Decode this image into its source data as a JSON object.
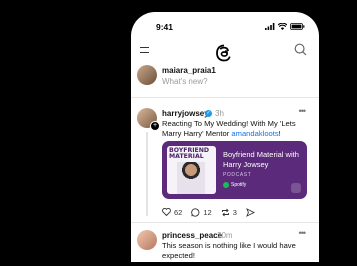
{
  "status_bar": {
    "time": "9:41"
  },
  "compose": {
    "username": "maiara_praia1",
    "placeholder": "What's new?"
  },
  "post": {
    "author": "harryjowsey",
    "age": "3h",
    "text": "Reacting To My Wedding! With My 'Lets Marry Harry' Mentor ",
    "mention": "amandakloots",
    "text_end": "!",
    "card": {
      "cover_title": "BOYFRIEND MATERIAL",
      "title": "Boyfriend Material with Harry Jowsey",
      "subtitle": "PODCAST",
      "brand": "Spotify"
    },
    "actions": {
      "likes": "62",
      "comments": "12",
      "reposts": "3"
    }
  },
  "post2": {
    "author": "princess_peace",
    "age": "20m",
    "text": "This season is nothing like I would have expected!"
  },
  "colors": {
    "accent_purple": "#5b2a7a",
    "link": "#1a73e8",
    "verified": "#1d9bf0",
    "spotify": "#1db954"
  }
}
